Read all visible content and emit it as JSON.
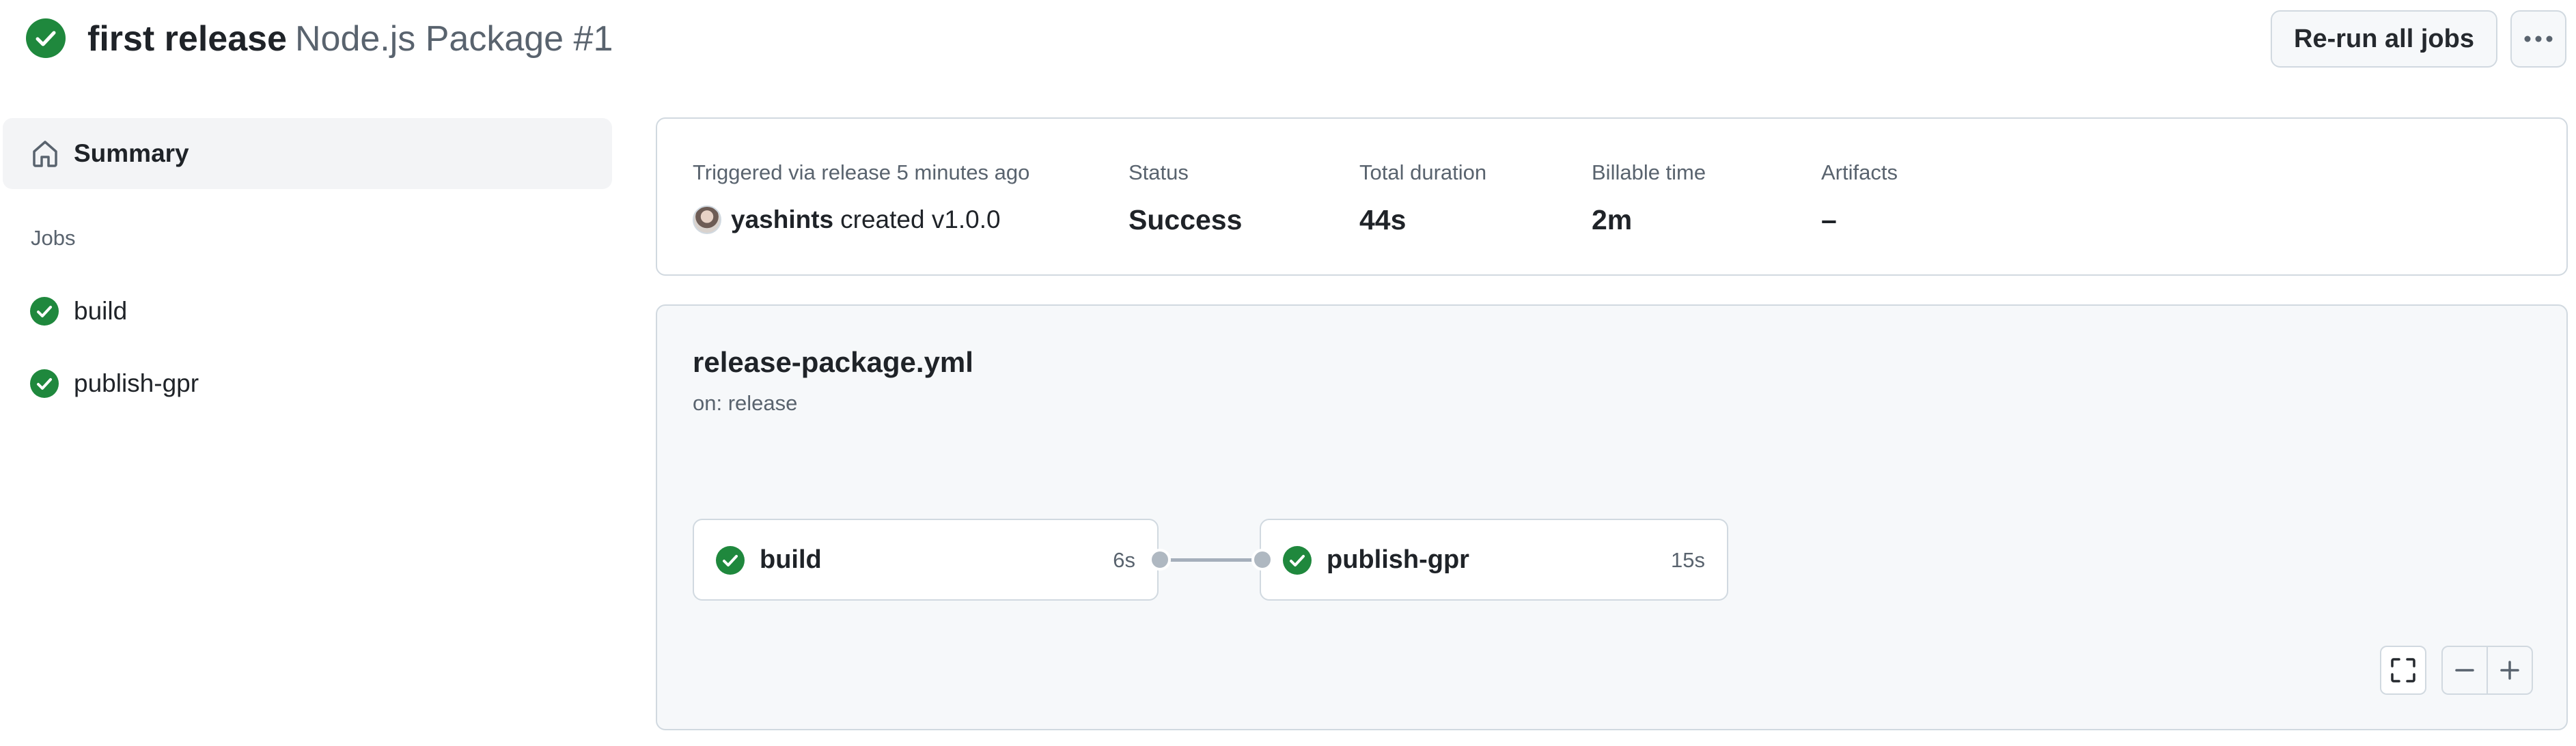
{
  "header": {
    "title": "first release",
    "subtitle": "Node.js Package #1",
    "status_icon": "check-circle-fill-icon",
    "rerun_label": "Re-run all jobs",
    "more_icon": "kebab-horizontal-icon"
  },
  "sidebar": {
    "summary_label": "Summary",
    "summary_icon": "home-icon",
    "jobs_heading": "Jobs",
    "jobs": [
      {
        "label": "build",
        "status_icon": "check-circle-fill-icon"
      },
      {
        "label": "publish-gpr",
        "status_icon": "check-circle-fill-icon"
      }
    ]
  },
  "summary": {
    "trigger_text": "Triggered via release 5 minutes ago",
    "actor": "yashints",
    "action": "created v1.0.0",
    "status_label": "Status",
    "status_value": "Success",
    "duration_label": "Total duration",
    "duration_value": "44s",
    "billable_label": "Billable time",
    "billable_value": "2m",
    "artifacts_label": "Artifacts",
    "artifacts_value": "–"
  },
  "workflow": {
    "file": "release-package.yml",
    "trigger": "on: release",
    "jobs": [
      {
        "name": "build",
        "duration": "6s"
      },
      {
        "name": "publish-gpr",
        "duration": "15s"
      }
    ],
    "controls": {
      "fit_icon": "screen-full-icon",
      "zoom_out_icon": "minus-icon",
      "zoom_in_icon": "plus-icon"
    }
  },
  "colors": {
    "success": "#1f883d",
    "border": "#d1d9e0",
    "muted_text": "#59636e",
    "canvas_bg": "#f6f8fa"
  }
}
